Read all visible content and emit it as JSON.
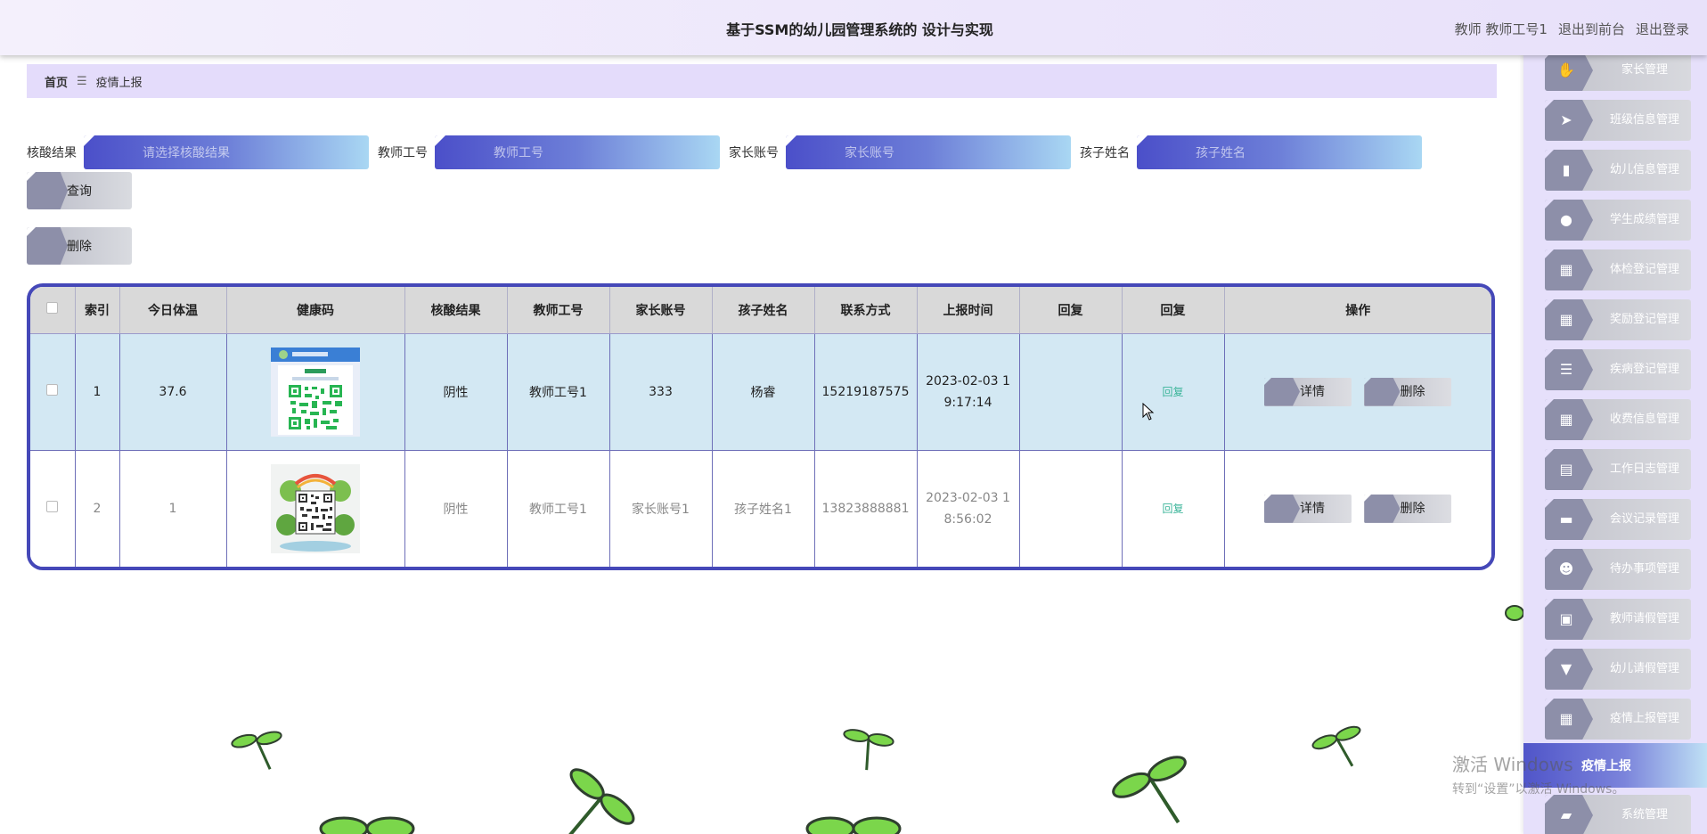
{
  "header": {
    "title": "基于SSM的幼儿园管理系统的 设计与实现",
    "user_label": "教师 教师工号1",
    "back_front": "退出到前台",
    "logout": "退出登录"
  },
  "breadcrumb": {
    "home": "首页",
    "separator": "☰",
    "current": "疫情上报"
  },
  "search": {
    "fields": [
      {
        "label": "核酸结果",
        "placeholder": "请选择核酸结果"
      },
      {
        "label": "教师工号",
        "placeholder": "教师工号"
      },
      {
        "label": "家长账号",
        "placeholder": "家长账号"
      },
      {
        "label": "孩子姓名",
        "placeholder": "孩子姓名"
      }
    ],
    "query_button": "查询",
    "delete_button": "删除"
  },
  "table": {
    "headers": [
      "",
      "索引",
      "今日体温",
      "健康码",
      "核酸结果",
      "教师工号",
      "家长账号",
      "孩子姓名",
      "联系方式",
      "上报时间",
      "回复",
      "回复",
      "操作"
    ],
    "rows": [
      {
        "index": "1",
        "temperature": "37.6",
        "health_code": "qr-code-image",
        "nucleic_result": "阴性",
        "teacher_id": "教师工号1",
        "parent_account": "333",
        "child_name": "杨睿",
        "phone": "15219187575",
        "report_time_line1": "2023-02-03 1",
        "report_time_line2": "9:17:14",
        "reply_text": "",
        "reply_link": "回复",
        "detail_button": "详情",
        "delete_button": "删除"
      },
      {
        "index": "2",
        "temperature": "1",
        "health_code": "qr-code-image",
        "nucleic_result": "阴性",
        "teacher_id": "教师工号1",
        "parent_account": "家长账号1",
        "child_name": "孩子姓名1",
        "phone": "13823888881",
        "report_time_line1": "2023-02-03 1",
        "report_time_line2": "8:56:02",
        "reply_text": "",
        "reply_link": "回复",
        "detail_button": "详情",
        "delete_button": "删除"
      }
    ]
  },
  "sidebar": {
    "items": [
      {
        "label": "家长管理",
        "icon": "thumbs-up-icon"
      },
      {
        "label": "班级信息管理",
        "icon": "send-icon"
      },
      {
        "label": "幼儿信息管理",
        "icon": "bar-chart-icon"
      },
      {
        "label": "学生成绩管理",
        "icon": "lightbulb-icon"
      },
      {
        "label": "体检登记管理",
        "icon": "grid-icon"
      },
      {
        "label": "奖励登记管理",
        "icon": "grid-icon"
      },
      {
        "label": "疾病登记管理",
        "icon": "list-icon"
      },
      {
        "label": "收费信息管理",
        "icon": "grid-icon"
      },
      {
        "label": "工作日志管理",
        "icon": "table-icon"
      },
      {
        "label": "会议记录管理",
        "icon": "print-icon"
      },
      {
        "label": "待办事项管理",
        "icon": "user-icon"
      },
      {
        "label": "教师请假管理",
        "icon": "clipboard-icon"
      },
      {
        "label": "幼儿请假管理",
        "icon": "stamp-icon"
      },
      {
        "label": "疫情上报管理",
        "icon": "grid-icon"
      }
    ],
    "active_subitem": "疫情上报",
    "last_item": {
      "label": "系统管理",
      "icon": "briefcase-icon"
    }
  },
  "watermark": {
    "line1": "激活 Windows",
    "line2": "转到“设置”以激活 Windows。"
  }
}
